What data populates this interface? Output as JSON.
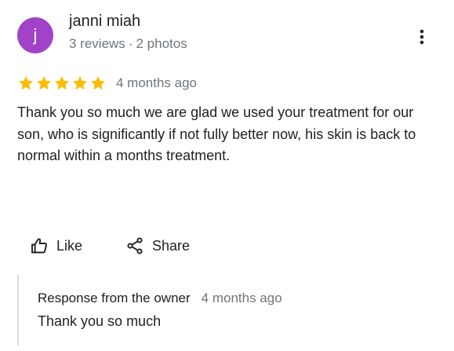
{
  "author": {
    "avatar_letter": "j",
    "avatar_color": "#a142c9",
    "name": "janni miah",
    "reviews": "3 reviews",
    "separator": "·",
    "photos": "2 photos"
  },
  "menu": {
    "icon": "more-vert-icon"
  },
  "review": {
    "rating": 5,
    "max_rating": 5,
    "star_color": "#fbbc04",
    "date": "4 months ago",
    "text": "Thank you so much we are glad we used your treatment for our son, who is significantly if not fully better now, his skin is back to normal within a months treatment."
  },
  "actions": {
    "like_label": "Like",
    "like_icon": "thumb-up-icon",
    "share_label": "Share",
    "share_icon": "share-icon"
  },
  "owner_response": {
    "title": "Response from the owner",
    "date": "4 months ago",
    "text": "Thank you so much",
    "border_color": "#dadce0"
  }
}
